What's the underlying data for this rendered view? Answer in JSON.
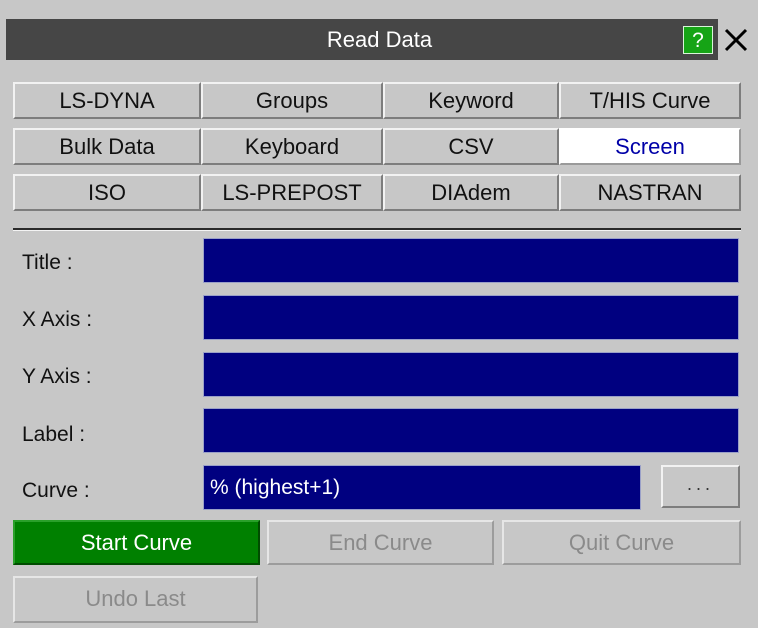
{
  "window": {
    "title": "Read Data",
    "help_label": "?"
  },
  "tabs": [
    {
      "label": "LS-DYNA"
    },
    {
      "label": "Groups"
    },
    {
      "label": "Keyword"
    },
    {
      "label": "T/HIS Curve"
    },
    {
      "label": "Bulk Data"
    },
    {
      "label": "Keyboard"
    },
    {
      "label": "CSV"
    },
    {
      "label": "Screen",
      "active": true
    },
    {
      "label": "ISO"
    },
    {
      "label": "LS-PREPOST"
    },
    {
      "label": "DIAdem"
    },
    {
      "label": "NASTRAN"
    }
  ],
  "form": {
    "title_label": "Title :",
    "title_value": "",
    "xaxis_label": "X Axis :",
    "xaxis_value": "",
    "yaxis_label": "Y Axis :",
    "yaxis_value": "",
    "label_label": "Label :",
    "label_value": "",
    "curve_label": "Curve :",
    "curve_value": "% (highest+1)",
    "curve_browse_label": "..."
  },
  "buttons": {
    "start_curve": "Start Curve",
    "end_curve": "End Curve",
    "quit_curve": "Quit Curve",
    "undo_last": "Undo Last"
  },
  "colors": {
    "field_background": "#000080",
    "active_tab_text": "#0000a8",
    "primary_button": "#008000",
    "help_button": "#16a416",
    "titlebar": "#464646"
  },
  "icons": {
    "help": "help-icon",
    "close": "close-icon"
  }
}
